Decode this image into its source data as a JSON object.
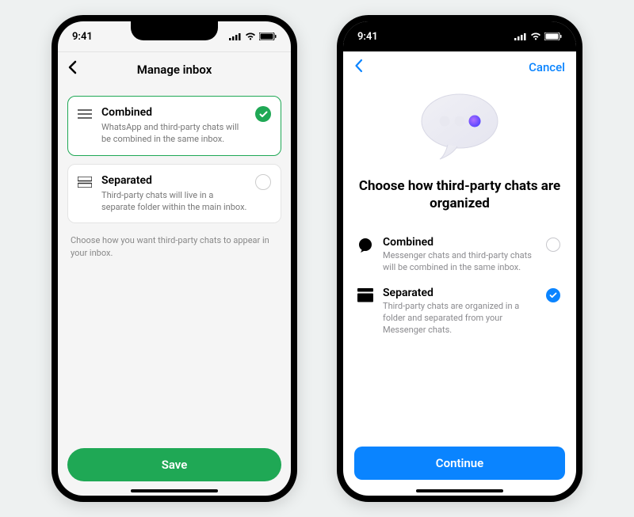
{
  "status": {
    "time": "9:41"
  },
  "left": {
    "title": "Manage inbox",
    "options": [
      {
        "title": "Combined",
        "desc": "WhatsApp and third-party chats will be combined in the same inbox.",
        "selected": true
      },
      {
        "title": "Separated",
        "desc": "Third-party chats will live in a separate folder within the main inbox.",
        "selected": false
      }
    ],
    "helper": "Choose how you want third-party chats to appear in your inbox.",
    "save_label": "Save"
  },
  "right": {
    "cancel_label": "Cancel",
    "title": "Choose how third-party chats are organized",
    "options": [
      {
        "title": "Combined",
        "desc": "Messenger chats and third-party chats will be combined in the same inbox.",
        "selected": false
      },
      {
        "title": "Separated",
        "desc": "Third-party chats are organized in a folder and separated from your Messenger chats.",
        "selected": true
      }
    ],
    "continue_label": "Continue"
  },
  "colors": {
    "whatsapp_green": "#1fa855",
    "ios_blue": "#0a84ff"
  }
}
